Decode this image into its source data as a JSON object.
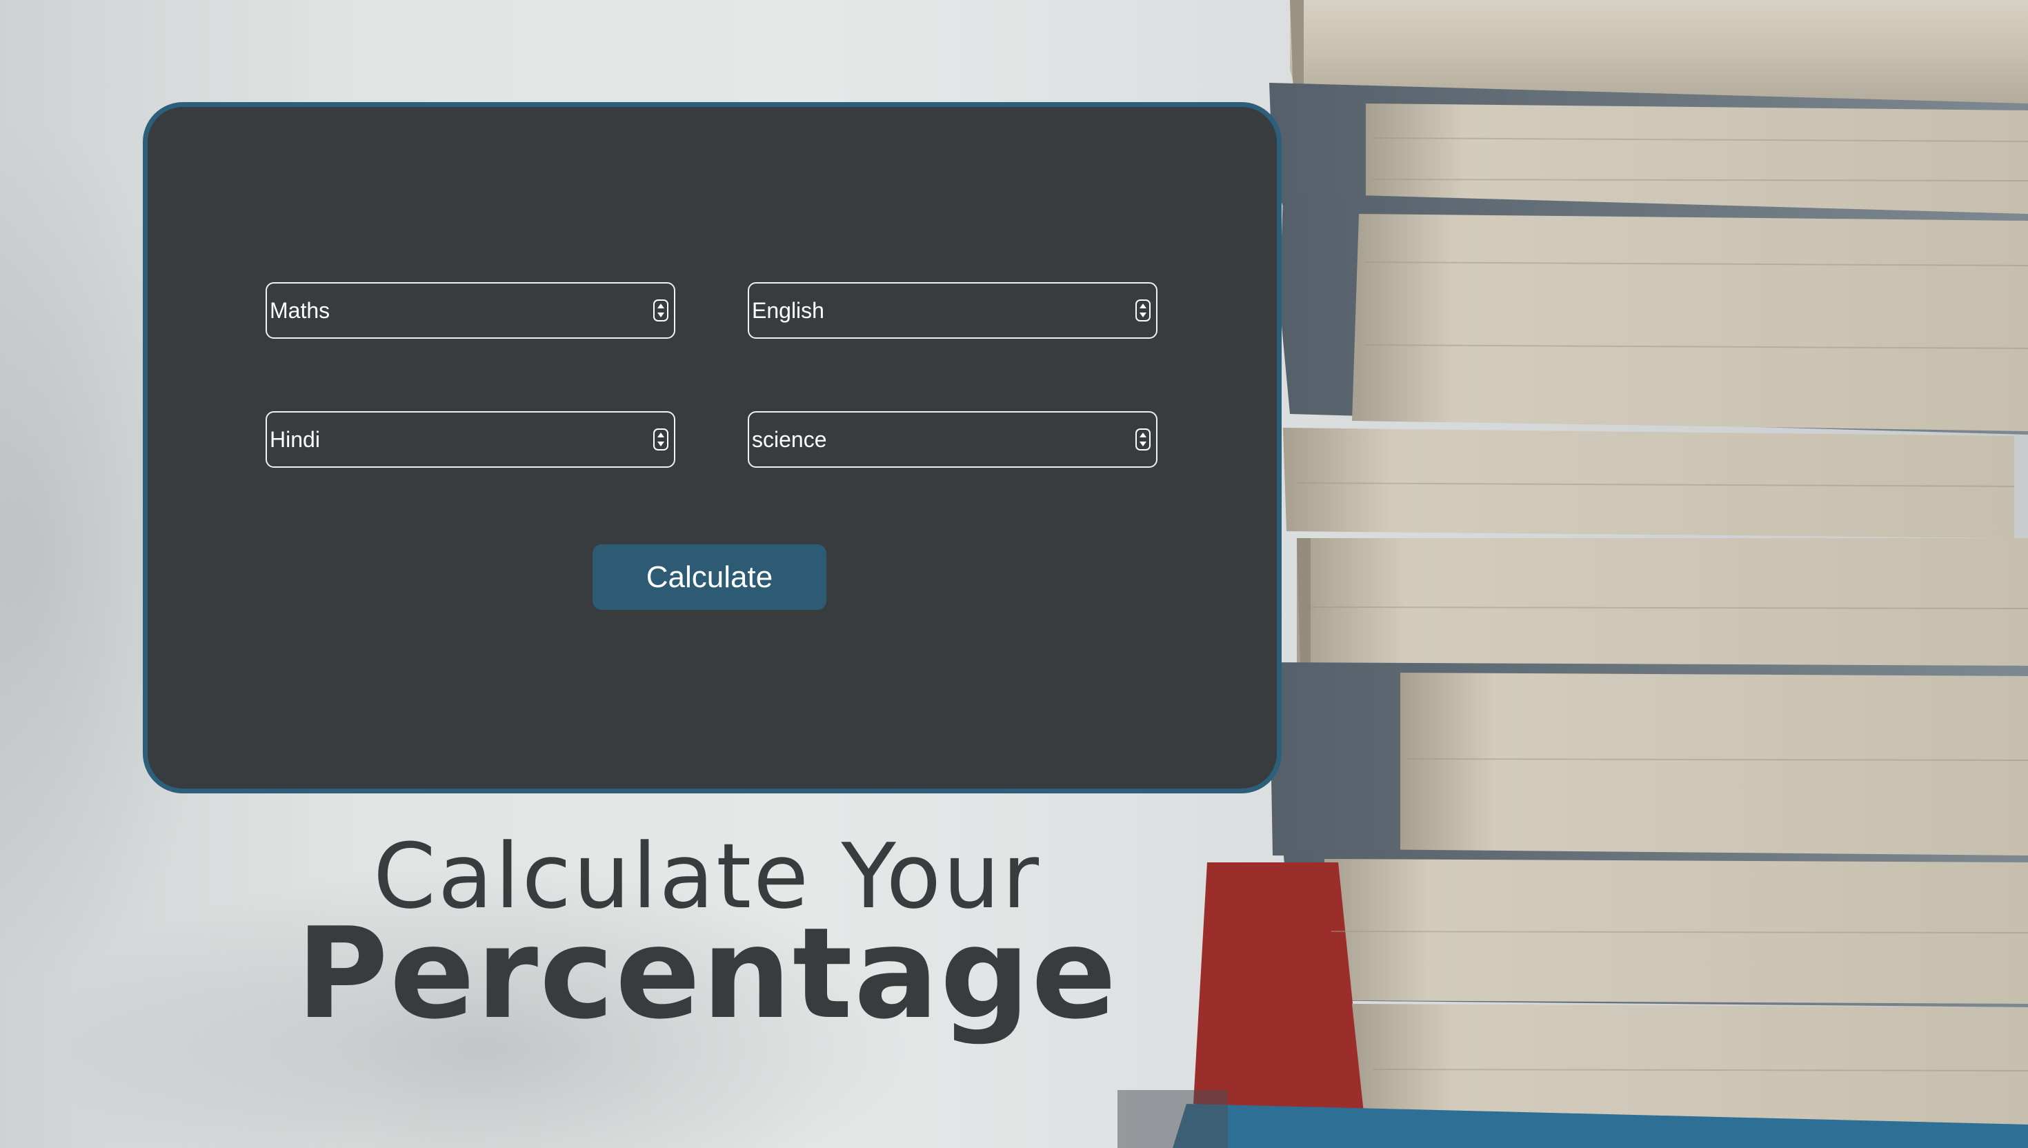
{
  "form": {
    "fields": [
      {
        "name": "maths",
        "value": "Maths"
      },
      {
        "name": "english",
        "value": "English"
      },
      {
        "name": "hindi",
        "value": "Hindi"
      },
      {
        "name": "science",
        "value": "science"
      }
    ],
    "button_label": "Calculate"
  },
  "headline": {
    "line1": "Calculate Your",
    "line2": "Percentage"
  },
  "colors": {
    "card_bg": "#393c3e",
    "card_border": "#2b5f7a",
    "button_bg": "#2c5b73",
    "text_dark": "#393c3e"
  },
  "background": {
    "image": "stack-of-books-photo"
  }
}
